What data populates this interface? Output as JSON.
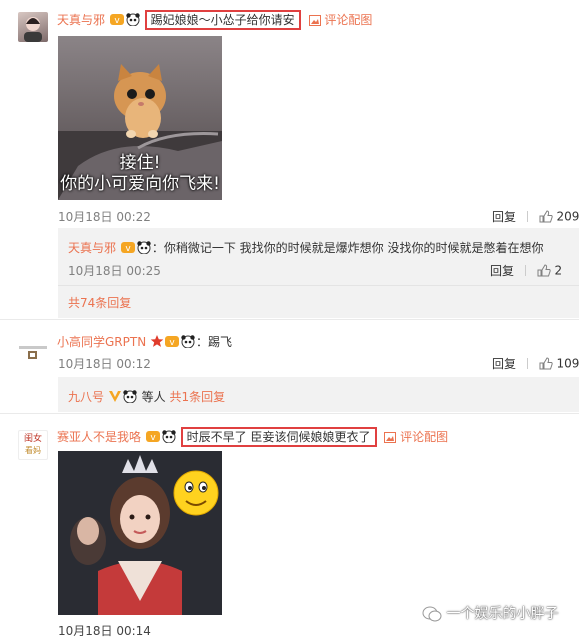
{
  "c1": {
    "user": "天真与邪",
    "text": "踢妃娘娘～小怂子给你请安",
    "pic_link": "评论配图",
    "image_caption_1": "接住!",
    "image_caption_2": "你的小可爱向你飞来!",
    "time": "10月18日 00:22",
    "reply": "回复",
    "likes": "209"
  },
  "c1_reply": {
    "user": "天真与邪",
    "text": "：你稍微记一下 我找你的时候就是爆炸想你 没找你的时候就是憋着在想你",
    "time": "10月18日 00:25",
    "reply": "回复",
    "likes": "2",
    "more": "共74条回复"
  },
  "c2": {
    "user": "小高同学GRPTN",
    "text": "：踢飞",
    "time": "10月18日 00:12",
    "reply": "回复",
    "likes": "109",
    "sub_user": "九八号",
    "sub_text": "等人",
    "sub_more": "共1条回复"
  },
  "c3": {
    "user": "赛亚人不是我咯",
    "text": "时辰不早了 臣妾该伺候娘娘更衣了",
    "pic_link": "评论配图",
    "time": "10月18日 00:14",
    "avatar_text_1": "闺女",
    "avatar_text_2": "看妈"
  },
  "watermark": "一个娱乐的小胖子",
  "colors": {
    "link": "#eb7350",
    "highlight": "#e04040",
    "reply_bg": "#f2f2f2"
  }
}
